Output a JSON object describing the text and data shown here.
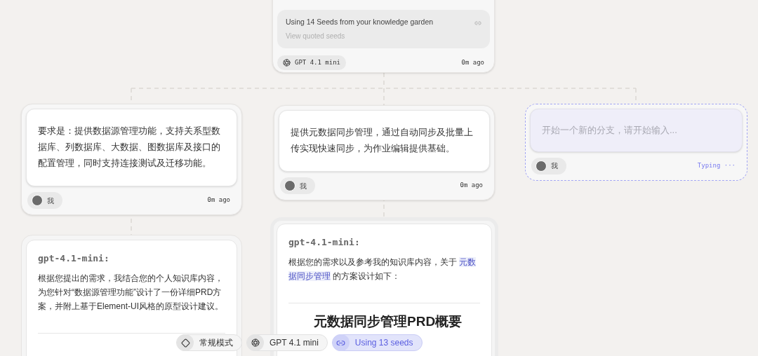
{
  "top_node": {
    "seeds": {
      "title": "Using 14 Seeds from your knowledge garden",
      "subtitle": "View quoted seeds"
    },
    "model": "GPT 4.1 mini",
    "time": "0m ago"
  },
  "branches": [
    {
      "kind": "user",
      "text": "要求是：提供数据源管理功能，支持关系型数据库、列数据库、大数据、图数据库及接口的配置管理，同时支持连接测试及迁移功能。",
      "author": "我",
      "time": "0m ago"
    },
    {
      "kind": "user",
      "text": "提供元数据同步管理，通过自动同步及批量上传实现快速同步，为作业编辑提供基础。",
      "author": "我",
      "time": "0m ago"
    },
    {
      "kind": "draft",
      "placeholder": "开始一个新的分支，请开始输入...",
      "author": "我",
      "status": "Typing ···"
    }
  ],
  "replies": [
    {
      "model_label": "gpt-4.1-mini:",
      "text_before": "根据您提出的需求，我结合您的个人知识库内容，为您针对“数据源管理功能”设计了一份详细PRD方案，并附上基于Element-UI风格的原型设计建议。",
      "selected": false
    },
    {
      "model_label": "gpt-4.1-mini:",
      "text_before": "根据您的需求以及参考我的知识库内容，关于 ",
      "highlight": "元数据同步管理",
      "text_after": " 的方案设计如下：",
      "heading": "元数据同步管理PRD概要",
      "selected": true
    }
  ],
  "toolbar": [
    {
      "kind": "mode",
      "label": "常规模式",
      "selected": false
    },
    {
      "kind": "model",
      "label": "GPT 4.1 mini",
      "selected": false
    },
    {
      "kind": "seeds",
      "label": "Using 13 seeds",
      "selected": true
    }
  ]
}
